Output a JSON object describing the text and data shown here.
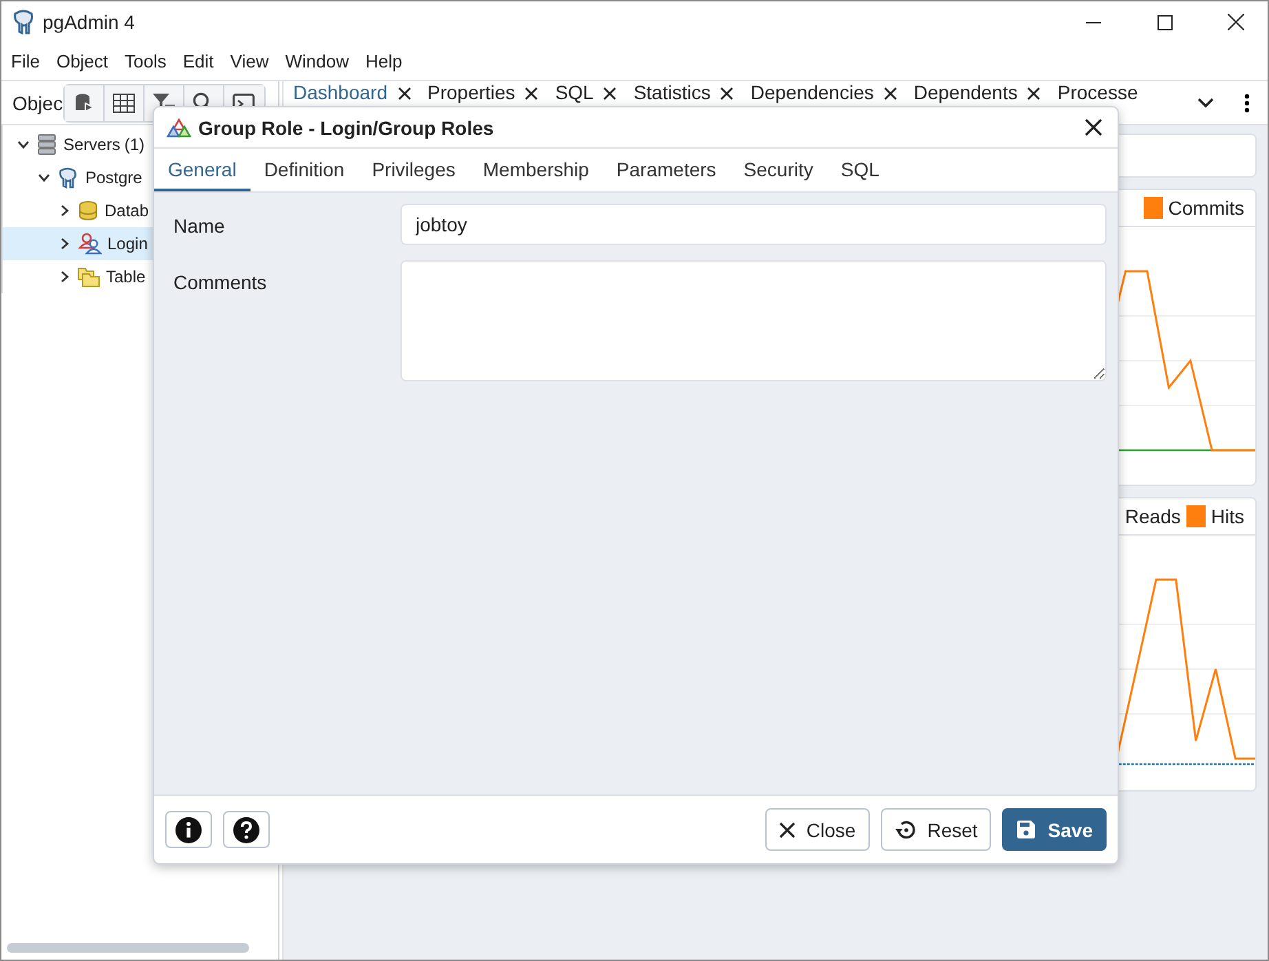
{
  "window": {
    "title": "pgAdmin 4"
  },
  "menu": [
    "File",
    "Object",
    "Tools",
    "Edit",
    "View",
    "Window",
    "Help"
  ],
  "browser": {
    "title": "Objec",
    "tree": [
      {
        "label": "Servers",
        "count": "(1)",
        "kind": "servers",
        "expanded": true,
        "selected": false,
        "children": [
          {
            "label": "Postgre",
            "kind": "server",
            "expanded": true,
            "selected": false,
            "children": [
              {
                "label": "Datab",
                "kind": "databases",
                "expanded": false,
                "selected": false
              },
              {
                "label": "Login",
                "kind": "roles",
                "expanded": false,
                "selected": true
              },
              {
                "label": "Table",
                "kind": "tablespaces",
                "expanded": false,
                "selected": false
              }
            ]
          }
        ]
      }
    ]
  },
  "tabs": [
    {
      "label": "Dashboard",
      "selected": true,
      "closable": true
    },
    {
      "label": "Properties",
      "selected": false,
      "closable": true
    },
    {
      "label": "SQL",
      "selected": false,
      "closable": true
    },
    {
      "label": "Statistics",
      "selected": false,
      "closable": true
    },
    {
      "label": "Dependencies",
      "selected": false,
      "closable": true
    },
    {
      "label": "Dependents",
      "selected": false,
      "closable": true
    },
    {
      "label": "Processe",
      "selected": false,
      "closable": false
    }
  ],
  "dashboard": {
    "panels": [
      {
        "legend": [
          {
            "label": "Commits",
            "color": "#ff7f0e"
          }
        ]
      },
      {
        "legend": [
          {
            "label": "Reads"
          },
          {
            "label": "Hits",
            "color": "#ff7f0e"
          }
        ]
      }
    ]
  },
  "dialog": {
    "title": "Group Role - Login/Group Roles",
    "tabs": [
      {
        "label": "General",
        "selected": true
      },
      {
        "label": "Definition",
        "selected": false
      },
      {
        "label": "Privileges",
        "selected": false
      },
      {
        "label": "Membership",
        "selected": false
      },
      {
        "label": "Parameters",
        "selected": false
      },
      {
        "label": "Security",
        "selected": false
      },
      {
        "label": "SQL",
        "selected": false
      }
    ],
    "fields": [
      {
        "label": "Name",
        "kind": "text",
        "value": "jobtoy"
      },
      {
        "label": "Comments",
        "kind": "textarea"
      }
    ],
    "buttons": [
      {
        "label": "Close",
        "kind": "close"
      },
      {
        "label": "Reset",
        "kind": "reset"
      },
      {
        "label": "Save",
        "kind": "save"
      }
    ]
  }
}
